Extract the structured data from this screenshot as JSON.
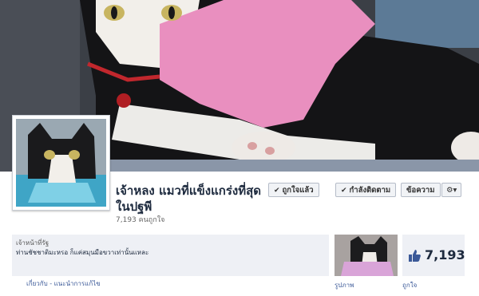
{
  "page": {
    "name": "เจ้าหลง แมวที่แข็งแกร่งที่สุดในปฐพี",
    "likes_count": "7,193 คนถูกใจ"
  },
  "actions": {
    "liked_label": "ถูกใจแล้ว",
    "following_label": "กำลังติดตาม",
    "message_label": "ข้อความ"
  },
  "about": {
    "category": "เจ้าหน้าที่รัฐ",
    "description": "ท่านชัชชาติมะหรอ ก็แค่สมุนมือขวาเท่านั้นแหละ",
    "links": "เกี่ยวกับ - แนะนำการแก้ไข"
  },
  "tiles": {
    "photos_label": "รูปภาพ",
    "likes_label": "ถูกใจ",
    "likes_number": "7,193"
  },
  "icons": {
    "liked": "check-icon",
    "following": "check-icon",
    "settings": "gear-icon",
    "like_tile": "thumbs-up-icon"
  }
}
